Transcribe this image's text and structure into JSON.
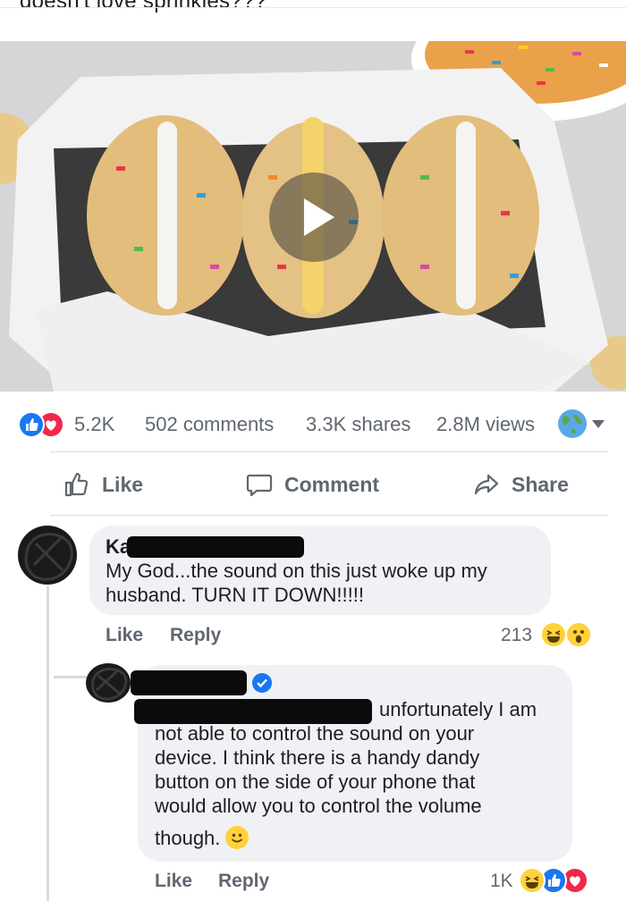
{
  "post": {
    "caption": "doesn't love sprinkles???"
  },
  "video": {
    "play_icon": "play-icon"
  },
  "stats": {
    "reactions_count": "5.2K",
    "comments": "502 comments",
    "shares": "3.3K shares",
    "views": "2.8M views",
    "reaction_icons": [
      "like-icon",
      "love-icon"
    ],
    "audience_icon": "globe-icon"
  },
  "actions": {
    "like": "Like",
    "comment": "Comment",
    "share": "Share"
  },
  "comment1": {
    "author_visible": "Ka",
    "text_line1": "My God...the sound on this just woke up my",
    "text_line2": "husband. TURN IT DOWN!!!!!",
    "like": "Like",
    "reply": "Reply",
    "reaction_count": "213",
    "reaction_icons": [
      "haha-icon",
      "wow-icon"
    ]
  },
  "reply1": {
    "text_line1": "unfortunately I am",
    "text_line2": "not able to control the sound on your",
    "text_line3": "device. I think there is a handy dandy",
    "text_line4": "button on the side of your phone that",
    "text_line5": "would allow you to control the volume",
    "text_line6": "though.",
    "verified_icon": "verified-badge-icon",
    "like": "Like",
    "reply": "Reply",
    "reaction_count": "1K",
    "reaction_icons": [
      "haha-icon",
      "like-icon",
      "love-icon"
    ]
  }
}
